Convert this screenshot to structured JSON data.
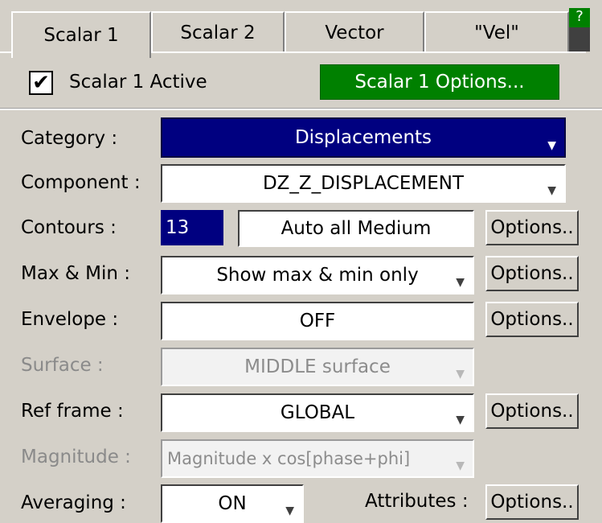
{
  "tabs": [
    {
      "label": "Scalar 1",
      "active": true
    },
    {
      "label": "Scalar 2",
      "active": false
    },
    {
      "label": "Vector",
      "active": false
    },
    {
      "label": "\"Vel\"",
      "active": false
    }
  ],
  "help": {
    "label": "?"
  },
  "active_checkbox": {
    "checked": true,
    "mark": "✔",
    "label": "Scalar 1 Active"
  },
  "options_button": {
    "label": "Scalar 1 Options..."
  },
  "rows": {
    "category": {
      "label": "Category :",
      "value": "Displacements"
    },
    "component": {
      "label": "Component :",
      "value": "DZ_Z_DISPLACEMENT"
    },
    "contours": {
      "label": "Contours :",
      "count": "13",
      "mode": "Auto all Medium",
      "options": "Options.."
    },
    "maxmin": {
      "label": "Max & Min :",
      "value": "Show max & min only",
      "options": "Options.."
    },
    "envelope": {
      "label": "Envelope :",
      "value": "OFF",
      "options": "Options.."
    },
    "surface": {
      "label": "Surface :",
      "value": "MIDDLE surface",
      "disabled": true
    },
    "refframe": {
      "label": "Ref frame :",
      "value": "GLOBAL",
      "options": "Options.."
    },
    "magnitude": {
      "label": "Magnitude :",
      "value": "Magnitude x cos[phase+phi]",
      "disabled": true
    },
    "averaging": {
      "label": "Averaging :",
      "value": "ON",
      "attributes_label": "Attributes :",
      "options": "Options.."
    }
  },
  "icons": {
    "dropdown": "triangle-down-icon"
  },
  "colors": {
    "background": "#d4d0c8",
    "green": "#008000",
    "navy": "#000080"
  }
}
